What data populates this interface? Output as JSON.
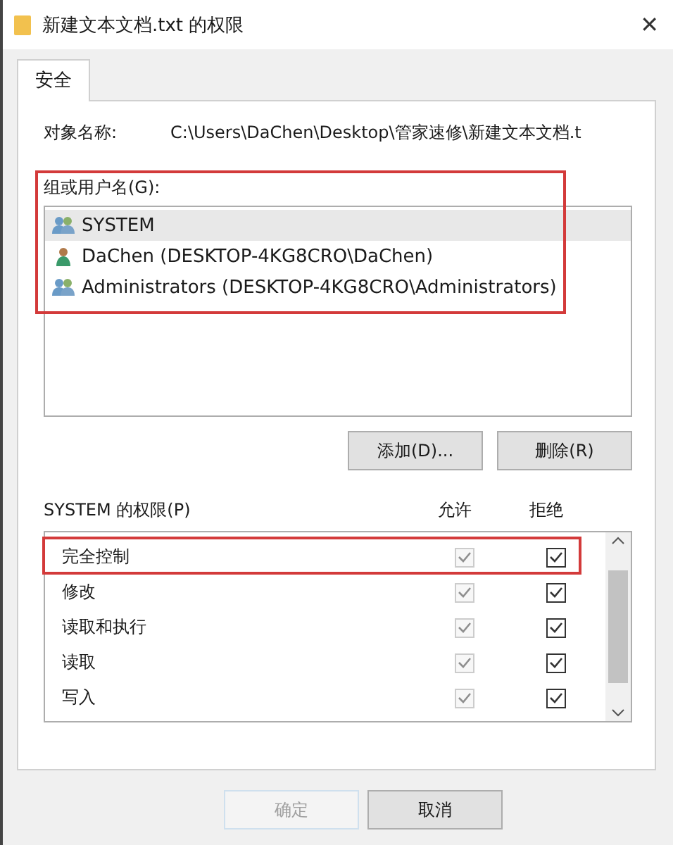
{
  "window": {
    "title": "新建文本文档.txt 的权限",
    "close": "✕"
  },
  "tabs": [
    {
      "label": "安全",
      "selected": true
    }
  ],
  "object": {
    "label": "对象名称:",
    "value": "C:\\Users\\DaChen\\Desktop\\管家速修\\新建文本文档.t"
  },
  "groups": {
    "label": "组或用户名(G):",
    "highlighted": true,
    "items": [
      {
        "name": "SYSTEM",
        "kind": "group",
        "selected": true
      },
      {
        "name": "DaChen (DESKTOP-4KG8CRO\\DaChen)",
        "kind": "user",
        "selected": false
      },
      {
        "name": "Administrators (DESKTOP-4KG8CRO\\Administrators)",
        "kind": "group",
        "selected": false
      }
    ]
  },
  "group_buttons": [
    "添加(D)...",
    "删除(R)"
  ],
  "permissions": {
    "label": "SYSTEM 的权限(P)",
    "columns": [
      "允许",
      "拒绝"
    ],
    "rows": [
      {
        "name": "完全控制",
        "highlighted": true,
        "allow": {
          "checked": true,
          "disabled": true
        },
        "deny": {
          "checked": true,
          "disabled": false
        }
      },
      {
        "name": "修改",
        "highlighted": false,
        "allow": {
          "checked": true,
          "disabled": true
        },
        "deny": {
          "checked": true,
          "disabled": false
        }
      },
      {
        "name": "读取和执行",
        "highlighted": false,
        "allow": {
          "checked": true,
          "disabled": true
        },
        "deny": {
          "checked": true,
          "disabled": false
        }
      },
      {
        "name": "读取",
        "highlighted": false,
        "allow": {
          "checked": true,
          "disabled": true
        },
        "deny": {
          "checked": true,
          "disabled": false
        }
      },
      {
        "name": "写入",
        "highlighted": false,
        "allow": {
          "checked": true,
          "disabled": true
        },
        "deny": {
          "checked": true,
          "disabled": false
        }
      }
    ]
  },
  "dialog_buttons": [
    {
      "label": "确定",
      "disabled": true
    },
    {
      "label": "取消",
      "disabled": false
    }
  ]
}
